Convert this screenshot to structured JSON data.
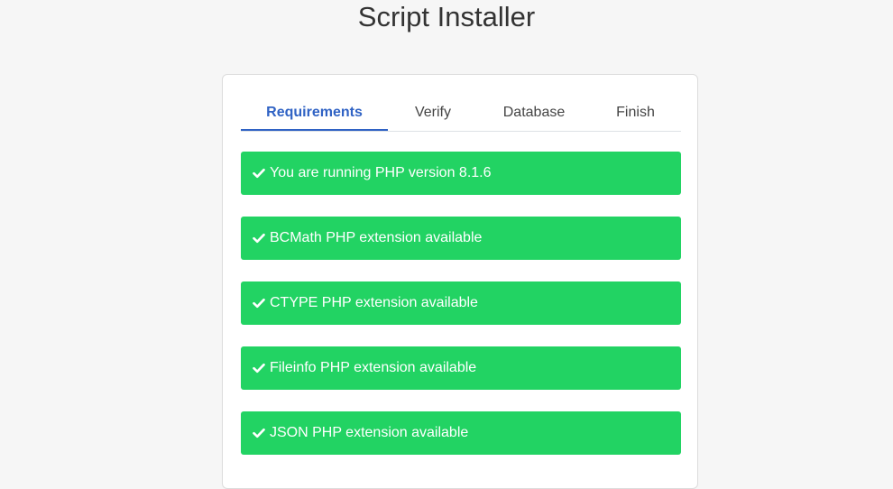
{
  "page": {
    "title": "Script Installer"
  },
  "tabs": [
    {
      "label": "Requirements",
      "active": true
    },
    {
      "label": "Verify",
      "active": false
    },
    {
      "label": "Database",
      "active": false
    },
    {
      "label": "Finish",
      "active": false
    }
  ],
  "requirements": [
    {
      "text": "You are running PHP version 8.1.6",
      "status": "ok"
    },
    {
      "text": "BCMath PHP extension available",
      "status": "ok"
    },
    {
      "text": "CTYPE PHP extension available",
      "status": "ok"
    },
    {
      "text": "Fileinfo PHP extension available",
      "status": "ok"
    },
    {
      "text": "JSON PHP extension available",
      "status": "ok"
    }
  ],
  "colors": {
    "success": "#22d363",
    "accent": "#2f62c4",
    "background": "#f6f6f6"
  },
  "icons": {
    "check": "check-icon"
  }
}
